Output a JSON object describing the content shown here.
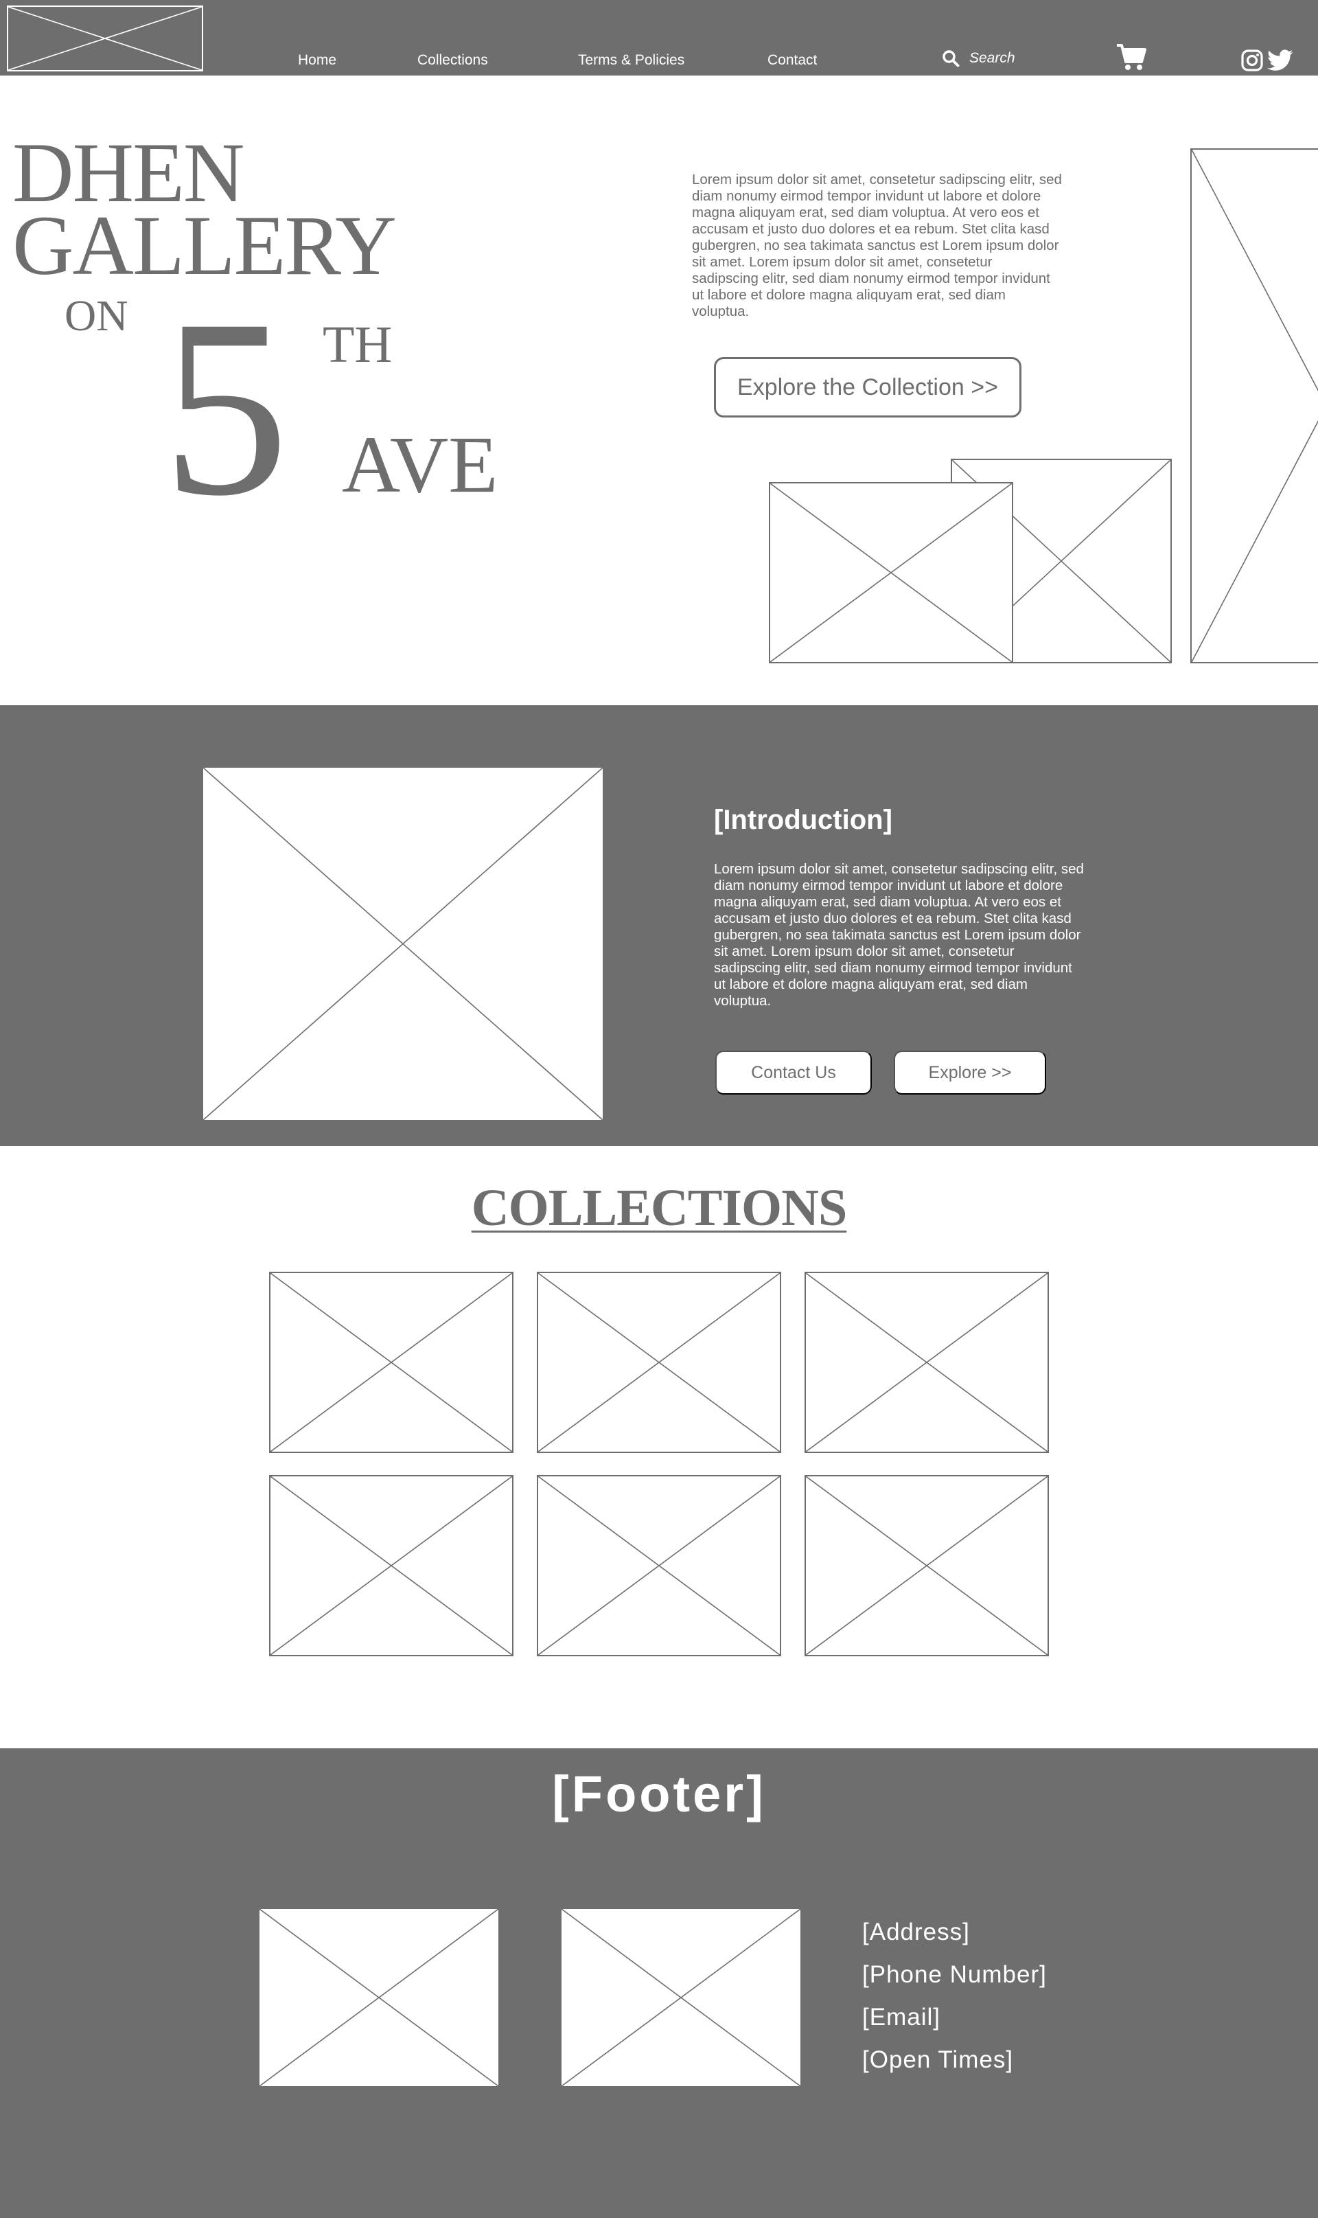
{
  "nav": {
    "links": [
      "Home",
      "Collections",
      "Terms & Policies",
      "Contact"
    ],
    "search_label": "Search"
  },
  "hero": {
    "title_line1": "DHEN",
    "title_line2": "GALLERY",
    "on": "ON",
    "number": "5",
    "suffix": "TH",
    "ave": "AVE",
    "text": "Lorem ipsum dolor sit amet, consetetur sadipscing elitr, sed diam nonumy eirmod tempor invidunt ut labore et dolore magna aliquyam erat, sed diam voluptua. At vero eos et accusam et justo duo dolores et ea rebum. Stet clita kasd gubergren, no sea takimata sanctus est Lorem ipsum dolor sit amet. Lorem ipsum dolor sit amet, consetetur sadipscing elitr, sed diam nonumy eirmod tempor invidunt ut labore et dolore magna aliquyam erat, sed diam voluptua.",
    "cta": "Explore the Collection >>"
  },
  "intro": {
    "title": "[Introduction]",
    "text": "Lorem ipsum dolor sit amet, consetetur sadipscing elitr, sed diam nonumy eirmod tempor invidunt ut labore et dolore magna aliquyam erat, sed diam voluptua. At vero eos et accusam et justo duo dolores et ea rebum. Stet clita kasd gubergren, no sea takimata sanctus est Lorem ipsum dolor sit amet. Lorem ipsum dolor sit amet, consetetur sadipscing elitr, sed diam nonumy eirmod tempor invidunt ut labore et dolore magna aliquyam erat, sed diam voluptua.",
    "contact_button": "Contact Us",
    "explore_button": "Explore >>"
  },
  "collections": {
    "title": "COLLECTIONS"
  },
  "footer": {
    "title": "[Footer]",
    "info": [
      "[Address]",
      "[Phone Number]",
      "[Email]",
      "[Open Times]"
    ]
  },
  "icons": {
    "search": "search-icon",
    "cart": "cart-icon",
    "instagram": "instagram-icon",
    "twitter": "twitter-icon"
  },
  "colors": {
    "primary_gray": "#6e6e6e",
    "background": "#ffffff",
    "on_dark_text": "#ffffff"
  }
}
